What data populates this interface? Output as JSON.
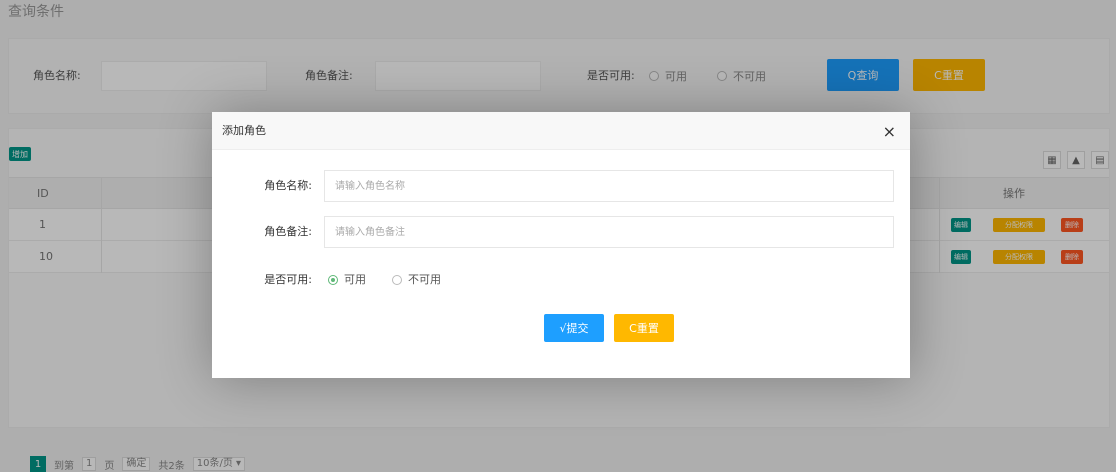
{
  "query": {
    "title": "查询条件",
    "role_name_label": "角色名称:",
    "role_remark_label": "角色备注:",
    "enabled_label": "是否可用:",
    "enabled_yes": "可用",
    "enabled_no": "不可用",
    "search_button": "Q查询",
    "reset_button": "C重置"
  },
  "table": {
    "add_button": "增加",
    "headers": {
      "id": "ID",
      "actions": "操作"
    },
    "rows": [
      {
        "id": "1",
        "edit": "编辑",
        "assign": "分配权限",
        "delete": "删除"
      },
      {
        "id": "10",
        "edit": "编辑",
        "assign": "分配权限",
        "delete": "删除"
      }
    ],
    "toolbar_icons": [
      "grid-icon",
      "export-icon",
      "print-icon"
    ]
  },
  "pagination": {
    "current_page": "1",
    "goto_label": "到第",
    "page_input": "1",
    "page_suffix": "页",
    "confirm": "确定",
    "total": "共2条",
    "page_size": "10条/页 ▾"
  },
  "dialog": {
    "title": "添加角色",
    "close": "×",
    "role_name_label": "角色名称:",
    "role_name_placeholder": "请输入角色名称",
    "role_remark_label": "角色备注:",
    "role_remark_placeholder": "请输入角色备注",
    "enabled_label": "是否可用:",
    "enabled_yes": "可用",
    "enabled_no": "不可用",
    "enabled_value": "可用",
    "submit_button": "√提交",
    "reset_button": "C重置"
  },
  "colors": {
    "blue": "#1E9FFF",
    "orange": "#FFB800",
    "green": "#009688",
    "red": "#FF5722",
    "radio_on": "#5FB878"
  }
}
